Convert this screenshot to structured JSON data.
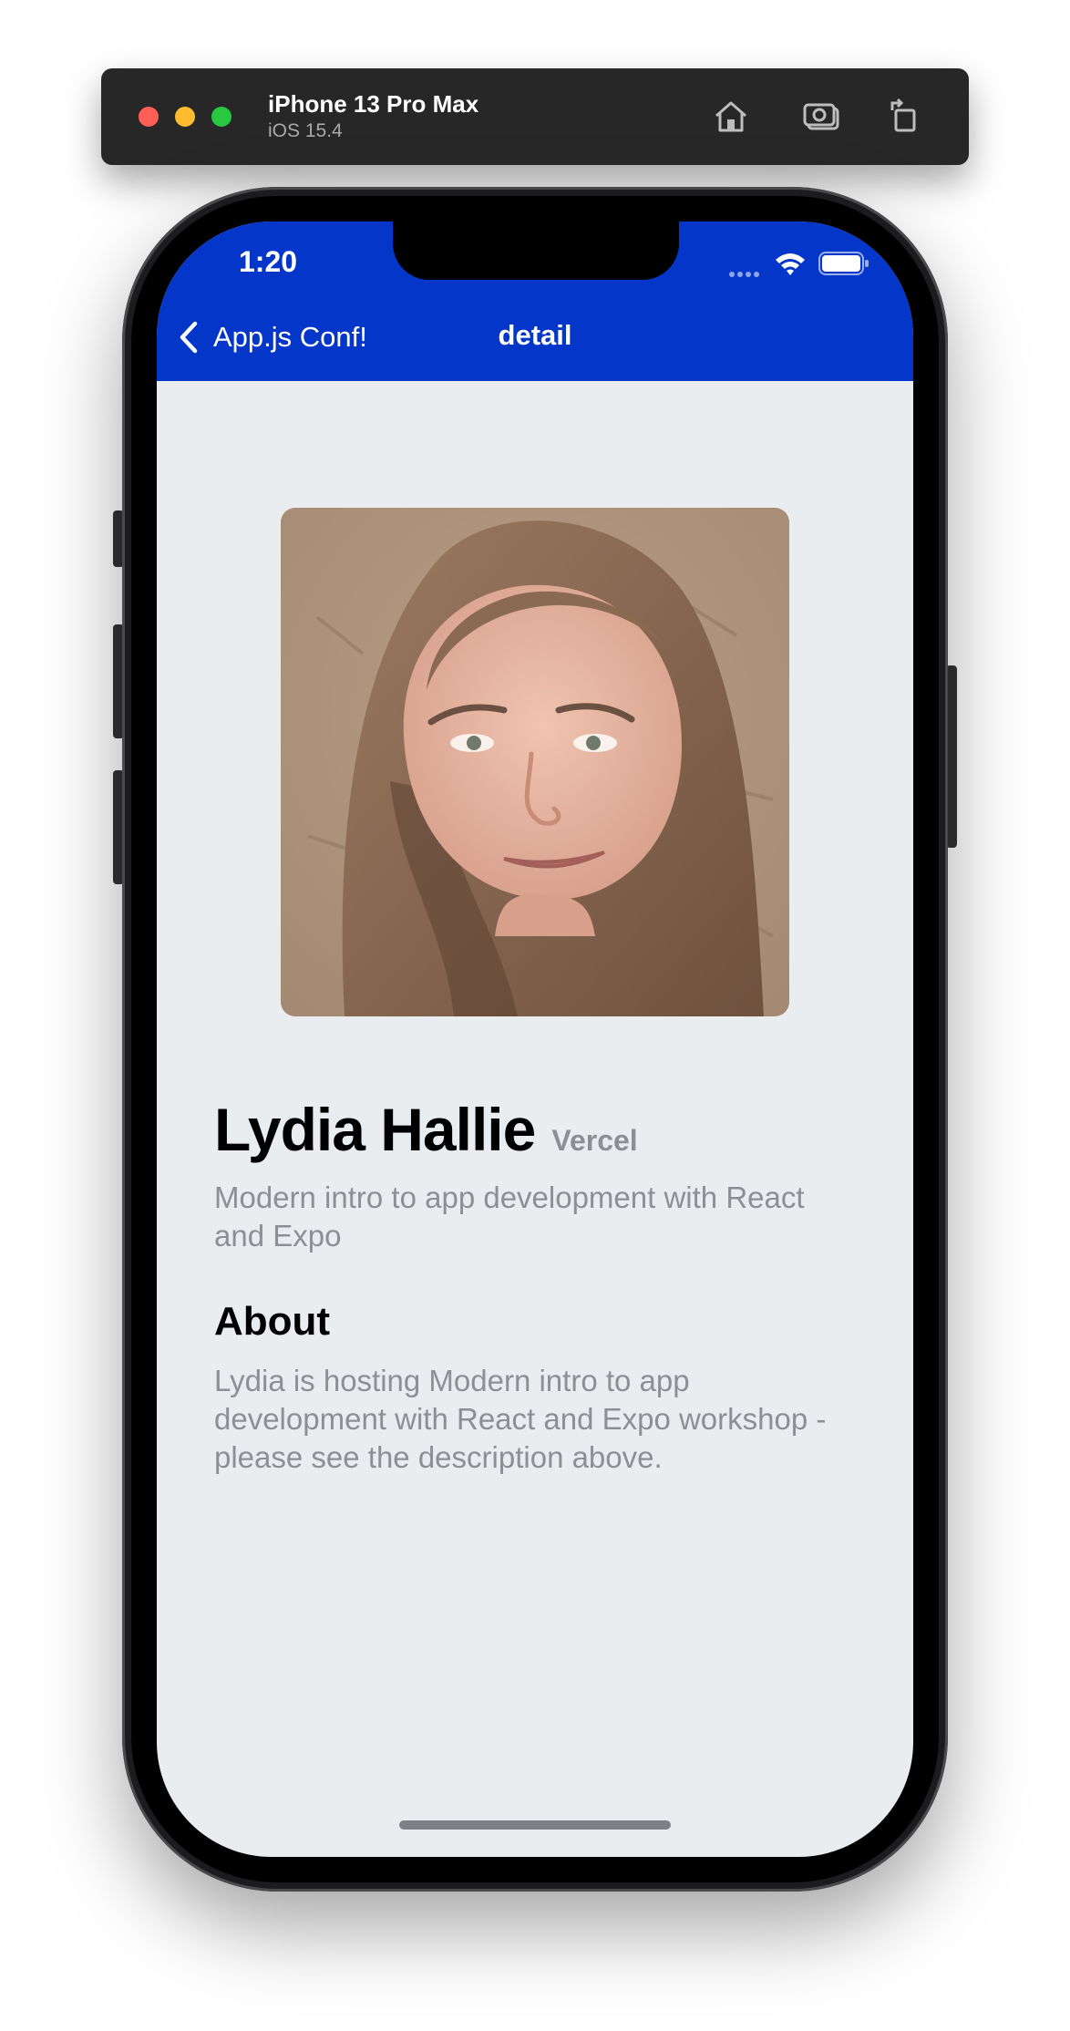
{
  "simulator": {
    "device_name": "iPhone 13 Pro Max",
    "os_version": "iOS 15.4",
    "toolbar_icons": [
      "home-icon",
      "camera-icon",
      "rotate-icon"
    ]
  },
  "status_bar": {
    "time": "1:20"
  },
  "nav": {
    "back_label": "App.js Conf!",
    "title": "detail"
  },
  "speaker": {
    "name": "Lydia Hallie",
    "company": "Vercel",
    "talk_title": "Modern intro to app development with React and Expo"
  },
  "about": {
    "heading": "About",
    "text": "Lydia is hosting Modern intro to app development with React and Expo workshop - please see the description above."
  },
  "colors": {
    "header": "#0336c9",
    "background": "#eaedef",
    "muted_text": "#8c8f94"
  }
}
